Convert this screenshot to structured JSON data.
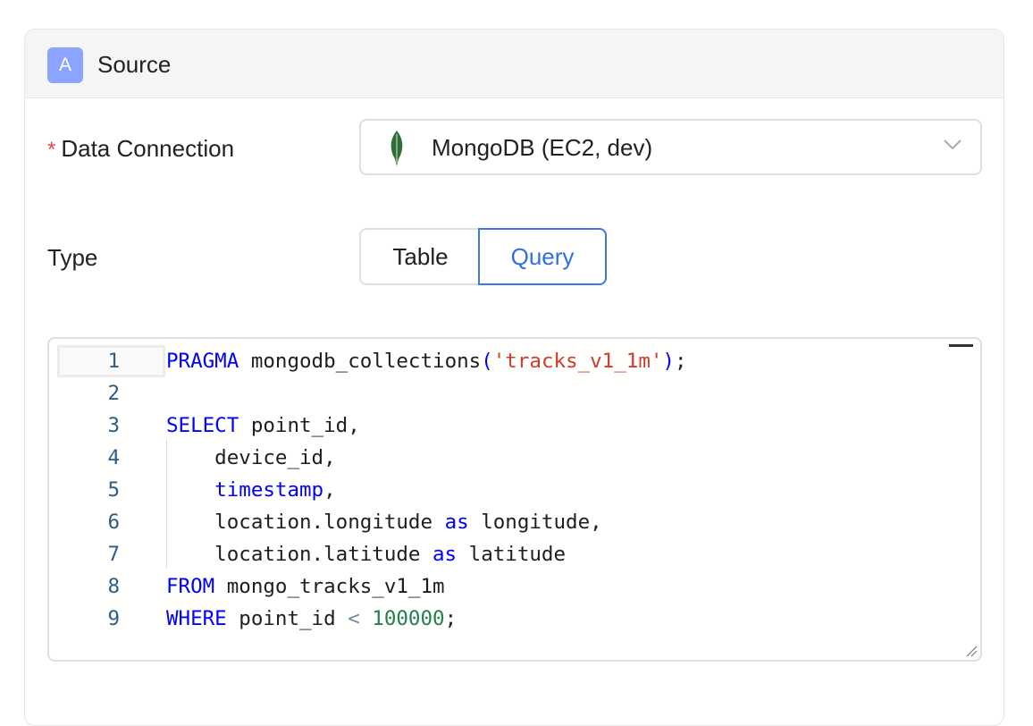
{
  "source": {
    "badge": "A",
    "title": "Source"
  },
  "data_connection": {
    "required_mark": "*",
    "label": "Data Connection",
    "selected_value": "MongoDB (EC2, dev)",
    "icon": "mongodb-leaf-icon"
  },
  "type_field": {
    "label": "Type",
    "options": [
      "Table",
      "Query"
    ],
    "selected": "Query"
  },
  "editor": {
    "language": "sql",
    "active_line": 1,
    "lines": [
      {
        "num": "1",
        "tokens": [
          {
            "t": "PRAGMA",
            "c": "kw"
          },
          {
            "t": " mongodb_collections",
            "c": "plain"
          },
          {
            "t": "(",
            "c": "kw"
          },
          {
            "t": "'tracks_v1_1m'",
            "c": "str"
          },
          {
            "t": ")",
            "c": "kw"
          },
          {
            "t": ";",
            "c": "plain"
          }
        ]
      },
      {
        "num": "2",
        "tokens": []
      },
      {
        "num": "3",
        "tokens": [
          {
            "t": "SELECT",
            "c": "kw"
          },
          {
            "t": " point_id,",
            "c": "plain"
          }
        ]
      },
      {
        "num": "4",
        "tokens": [
          {
            "t": "    device_id,",
            "c": "plain"
          }
        ]
      },
      {
        "num": "5",
        "tokens": [
          {
            "t": "    ",
            "c": "plain"
          },
          {
            "t": "timestamp",
            "c": "kw"
          },
          {
            "t": ",",
            "c": "plain"
          }
        ]
      },
      {
        "num": "6",
        "tokens": [
          {
            "t": "    location.longitude ",
            "c": "plain"
          },
          {
            "t": "as",
            "c": "kw"
          },
          {
            "t": " longitude,",
            "c": "plain"
          }
        ]
      },
      {
        "num": "7",
        "tokens": [
          {
            "t": "    location.latitude ",
            "c": "plain"
          },
          {
            "t": "as",
            "c": "kw"
          },
          {
            "t": " latitude",
            "c": "plain"
          }
        ]
      },
      {
        "num": "8",
        "tokens": [
          {
            "t": "FROM",
            "c": "kw"
          },
          {
            "t": " mongo_tracks_v1_1m",
            "c": "plain"
          }
        ]
      },
      {
        "num": "9",
        "tokens": [
          {
            "t": "WHERE",
            "c": "kw"
          },
          {
            "t": " point_id ",
            "c": "plain"
          },
          {
            "t": "<",
            "c": "op"
          },
          {
            "t": " ",
            "c": "plain"
          },
          {
            "t": "100000",
            "c": "num"
          },
          {
            "t": ";",
            "c": "plain"
          }
        ]
      }
    ]
  },
  "colors": {
    "badge_bg": "#8aa4ff",
    "accent": "#3f77e6",
    "required": "#e5484d",
    "mongodb_green": "#2f6e3a",
    "keyword": "#0000ff",
    "string": "#d13b2a",
    "number": "#22804f"
  }
}
